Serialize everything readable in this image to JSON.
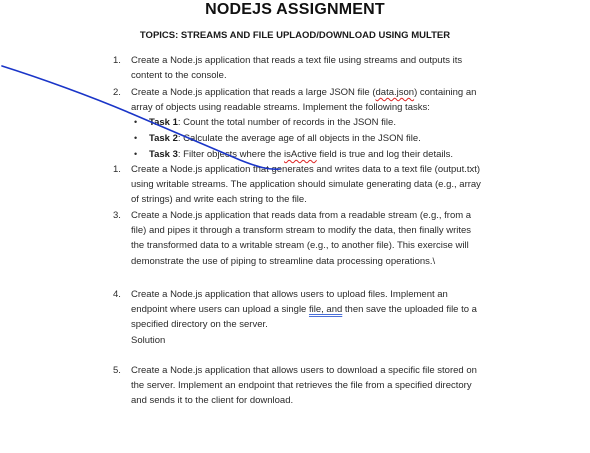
{
  "title": "NODEJS ASSIGNMENT",
  "subtitle": "TOPICS: STREAMS AND FILE UPLAOD/DOWNLOAD USING MULTER",
  "items": [
    {
      "num": "1.",
      "lines": [
        "Create a Node.js application that reads a text file using streams and outputs its",
        "content to the console."
      ]
    },
    {
      "num": "2.",
      "lines_a": "Create a Node.js application that reads a large JSON file (",
      "lines_a_sq": "data.json",
      "lines_a_end": ") containing an",
      "lines_b": "array of objects using readable streams. Implement the following tasks:"
    },
    {
      "num": "1.",
      "lines": [
        "Create a Node.js application that generates and writes data to a text file (output.txt)",
        "using writable streams. The application should simulate generating data (e.g., array",
        "of strings) and write each string to the file."
      ]
    },
    {
      "num": "3.",
      "lines": [
        "Create a Node.js application that reads data from a readable stream (e.g., from a",
        "file) and pipes it through a transform stream to modify the data, then finally writes",
        "the transformed data to a writable stream (e.g., to another file). This exercise will",
        "demonstrate the use of piping to streamline data processing operations.\\"
      ]
    },
    {
      "num": "4.",
      "line1": "Create a Node.js application that allows users to upload files. Implement an",
      "line2_a": "endpoint where users can upload a single ",
      "line2_sq": "file, and",
      "line2_end": " then save the uploaded file to a",
      "line3": "specified directory on the server.",
      "line4": "Solution"
    },
    {
      "num": "5.",
      "lines": [
        "Create a Node.js application that allows users to download a specific file stored on",
        "the server. Implement an endpoint that retrieves the file from a specified directory",
        "and sends it to the client for download."
      ]
    }
  ],
  "tasks": [
    {
      "bullet": "•",
      "label": "Task 1",
      "text": ": Count the total number of records in the JSON file."
    },
    {
      "bullet": "•",
      "label": "Task 2",
      "text": ": Calculate the average age of all objects in the JSON file."
    },
    {
      "bullet": "•",
      "label": "Task 3",
      "text_a": ": Filter objects where the ",
      "text_sq": "isActive",
      "text_end": " field is true and log their details."
    }
  ]
}
